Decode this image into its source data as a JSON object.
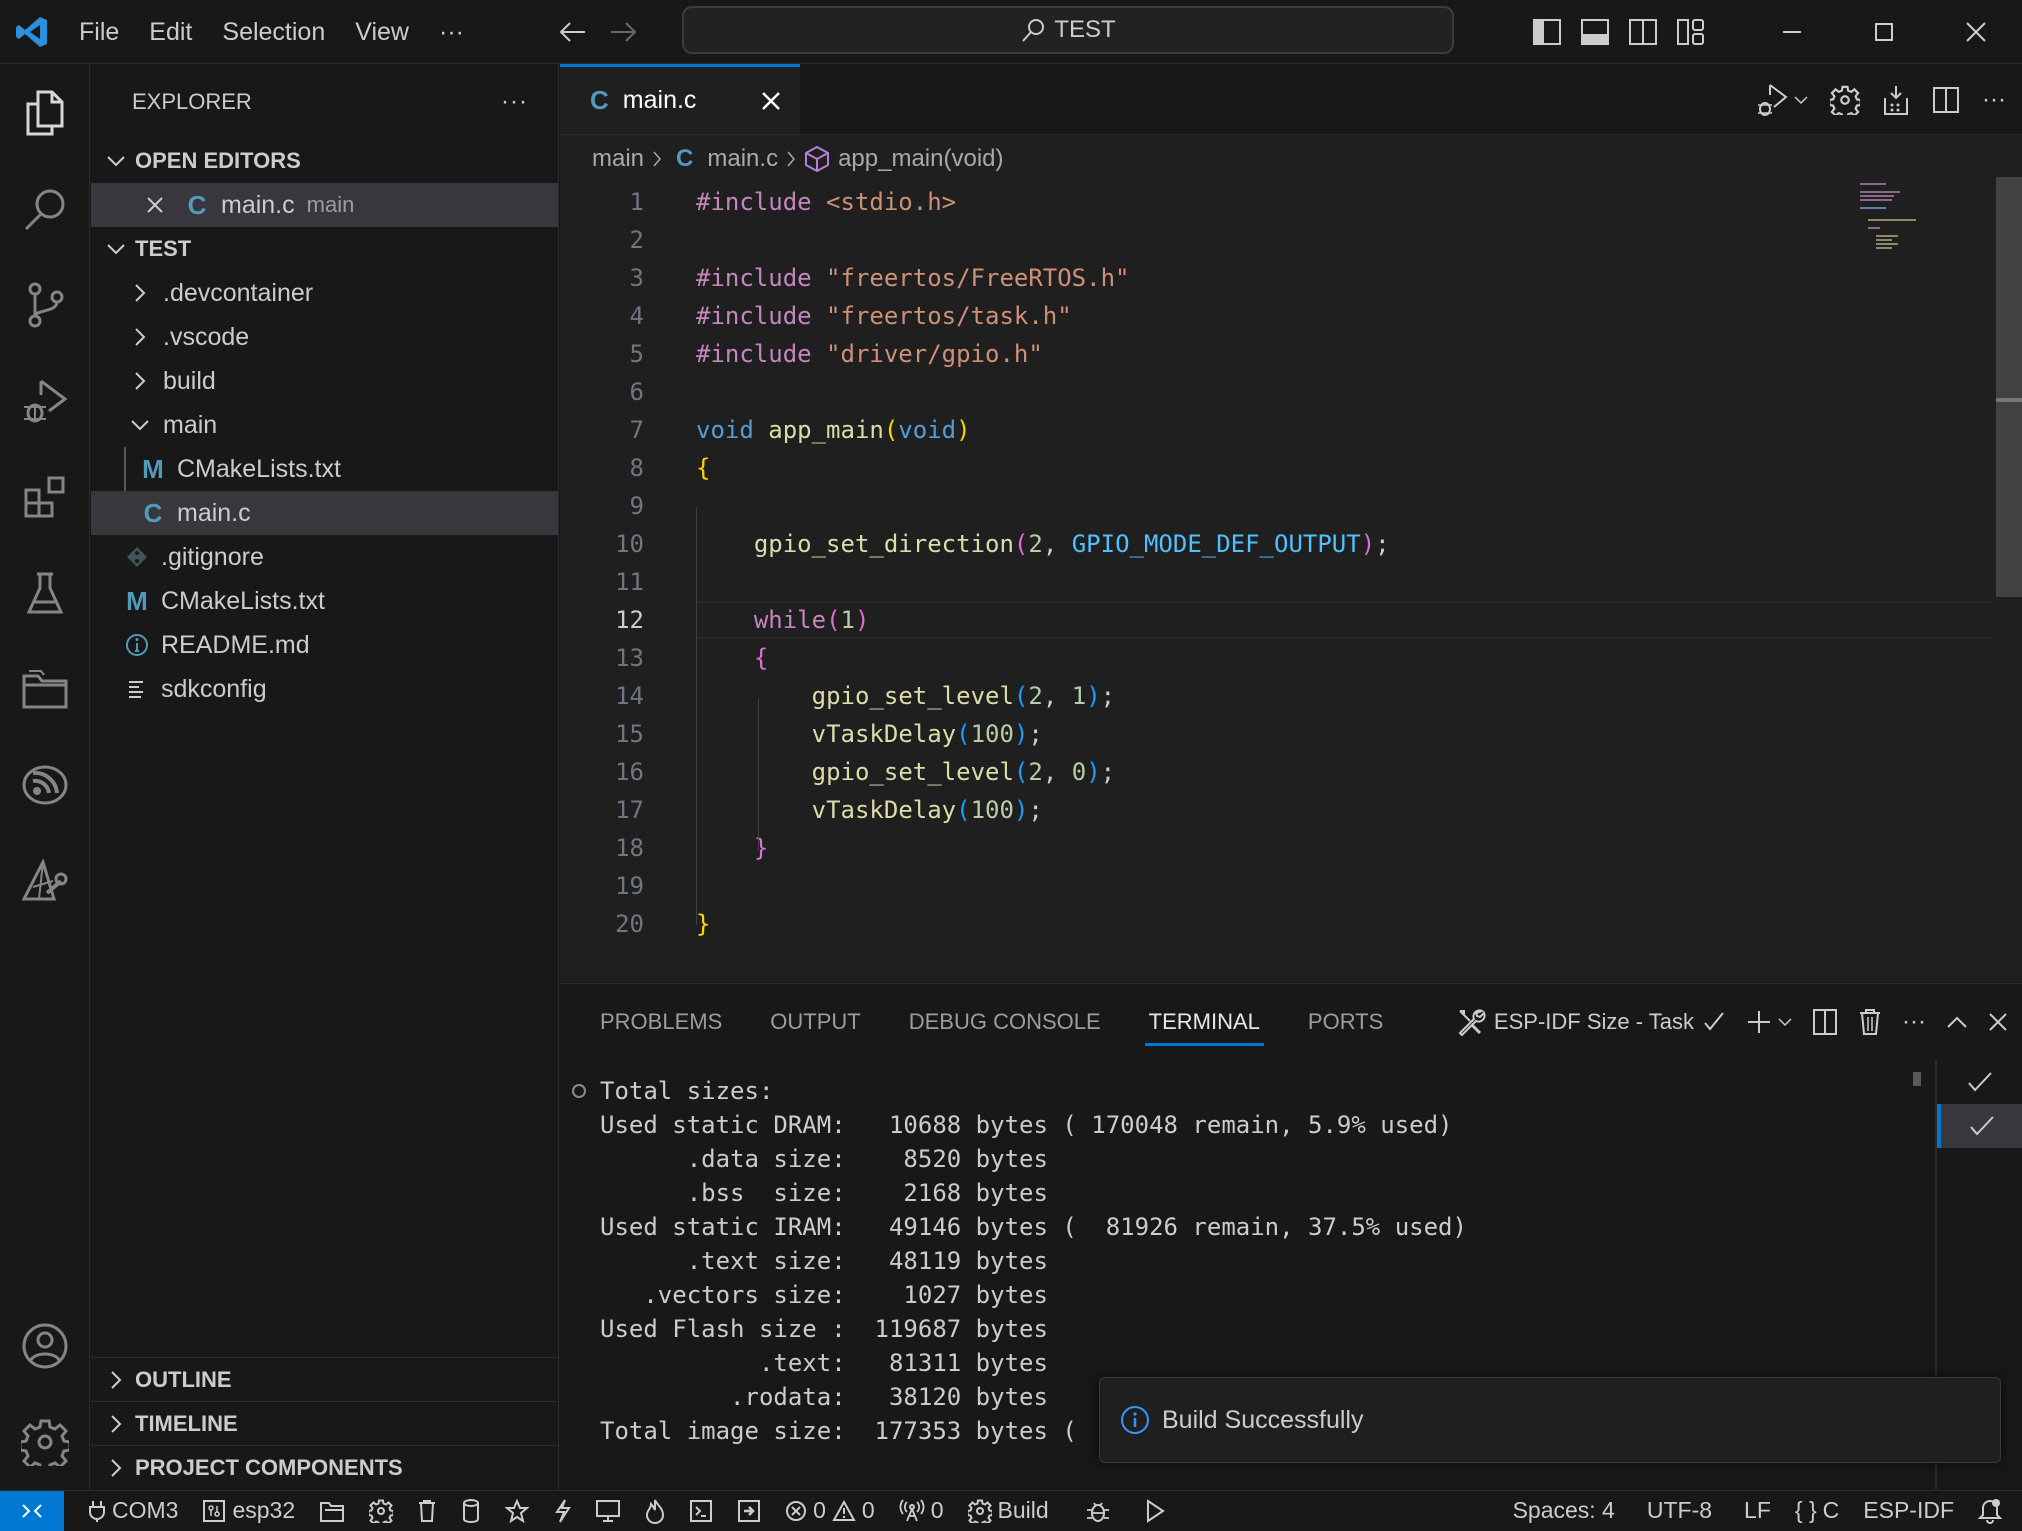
{
  "titlebar": {
    "menu": [
      "File",
      "Edit",
      "Selection",
      "View",
      "···"
    ],
    "command_center": "TEST"
  },
  "activity_bar": {
    "items": [
      "explorer",
      "search",
      "source-control",
      "run-and-debug",
      "extensions",
      "testing",
      "remote-explorer",
      "esp-idf",
      "esp-idf-tools"
    ],
    "bottom": [
      "accounts",
      "manage"
    ]
  },
  "sidebar": {
    "title": "EXPLORER",
    "more": "···",
    "open_editors": {
      "label": "OPEN EDITORS",
      "items": [
        {
          "name": "main.c",
          "description": "main",
          "icon": "C"
        }
      ]
    },
    "project": {
      "label": "TEST",
      "items": [
        {
          "name": ".devcontainer",
          "type": "folder",
          "expanded": false
        },
        {
          "name": ".vscode",
          "type": "folder",
          "expanded": false
        },
        {
          "name": "build",
          "type": "folder",
          "expanded": false
        },
        {
          "name": "main",
          "type": "folder",
          "expanded": true
        },
        {
          "name": "CMakeLists.txt",
          "type": "file",
          "icon": "M",
          "parent": "main"
        },
        {
          "name": "main.c",
          "type": "file",
          "icon": "C",
          "parent": "main",
          "selected": true
        },
        {
          "name": ".gitignore",
          "type": "file",
          "icon": "git"
        },
        {
          "name": "CMakeLists.txt",
          "type": "file",
          "icon": "M"
        },
        {
          "name": "README.md",
          "type": "file",
          "icon": "info"
        },
        {
          "name": "sdkconfig",
          "type": "file",
          "icon": "lines"
        }
      ]
    },
    "bottom_sections": [
      "OUTLINE",
      "TIMELINE",
      "PROJECT COMPONENTS"
    ]
  },
  "editor": {
    "tab": {
      "icon": "C",
      "name": "main.c"
    },
    "breadcrumb": [
      "main",
      "main.c",
      "app_main(void)"
    ],
    "current_line": 12,
    "lines": [
      "#include <stdio.h>",
      "",
      "#include \"freertos/FreeRTOS.h\"",
      "#include \"freertos/task.h\"",
      "#include \"driver/gpio.h\"",
      "",
      "void app_main(void)",
      "{",
      "",
      "    gpio_set_direction(2, GPIO_MODE_DEF_OUTPUT);",
      "",
      "    while(1)",
      "    {",
      "        gpio_set_level(2, 1);",
      "        vTaskDelay(100);",
      "        gpio_set_level(2, 0);",
      "        vTaskDelay(100);",
      "    }",
      "",
      "}"
    ]
  },
  "panel": {
    "tabs": [
      "PROBLEMS",
      "OUTPUT",
      "DEBUG CONSOLE",
      "TERMINAL",
      "PORTS"
    ],
    "active_tab": "TERMINAL",
    "task_label": "ESP-IDF Size - Task",
    "terminal_lines": [
      "Total sizes:",
      "Used static DRAM:   10688 bytes ( 170048 remain, 5.9% used)",
      "      .data size:    8520 bytes",
      "      .bss  size:    2168 bytes",
      "Used static IRAM:   49146 bytes (  81926 remain, 37.5% used)",
      "      .text size:   48119 bytes",
      "   .vectors size:    1027 bytes",
      "Used Flash size :  119687 bytes",
      "           .text:   81311 bytes",
      "         .rodata:   38120 bytes",
      "Total image size:  177353 bytes ("
    ]
  },
  "notification": {
    "message": "Build Successfully",
    "type": "info"
  },
  "statusbar": {
    "port": "COM3",
    "target": "esp32",
    "errors": "0",
    "warnings": "0",
    "ports_count": "0",
    "build": "Build",
    "spaces": "Spaces: 4",
    "encoding": "UTF-8",
    "eol": "LF",
    "language": "C",
    "framework": "ESP-IDF"
  },
  "colors": {
    "accent": "#0078d4",
    "keyword": "#c586c0",
    "type": "#569cd6",
    "function": "#dcdcaa",
    "string": "#ce9178",
    "number": "#b5cea8",
    "file_icon": "#519aba"
  }
}
